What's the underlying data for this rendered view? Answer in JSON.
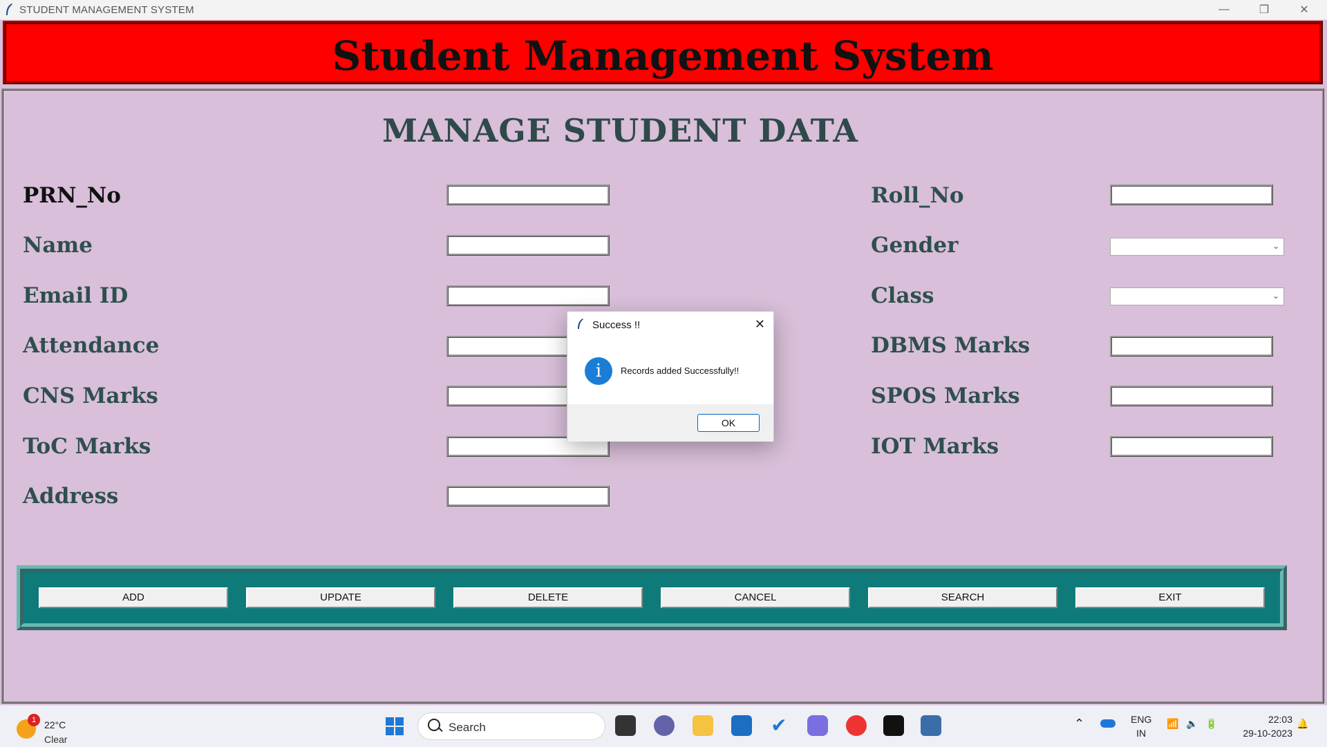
{
  "window": {
    "title": "STUDENT MANAGEMENT SYSTEM"
  },
  "header": {
    "title": "Student Management System"
  },
  "main": {
    "title": "MANAGE STUDENT DATA",
    "left_fields": [
      "PRN_No",
      "Name",
      "Email ID",
      "Attendance",
      "CNS Marks",
      "ToC Marks",
      "Address"
    ],
    "right_fields": [
      "Roll_No",
      "Gender",
      "Class",
      "DBMS Marks",
      "SPOS Marks",
      "IOT Marks"
    ]
  },
  "buttons": [
    "ADD",
    "UPDATE",
    "DELETE",
    "CANCEL",
    "SEARCH",
    "EXIT"
  ],
  "dialog": {
    "title": "Success !!",
    "message": "Records added Successfully!!",
    "ok_label": "OK",
    "icon": "info-icon"
  },
  "taskbar": {
    "weather_temp": "22°C",
    "weather_condition": "Clear",
    "notification_count": "1",
    "search_placeholder": "Search",
    "language_top": "ENG",
    "language_bottom": "IN",
    "time": "22:03",
    "date": "29-10-2023"
  },
  "colors": {
    "header_bg": "#ff0000",
    "page_bg": "#d9bfd9",
    "button_bar_bg": "#0f7a7a",
    "label_color": "#2f4f4f"
  }
}
